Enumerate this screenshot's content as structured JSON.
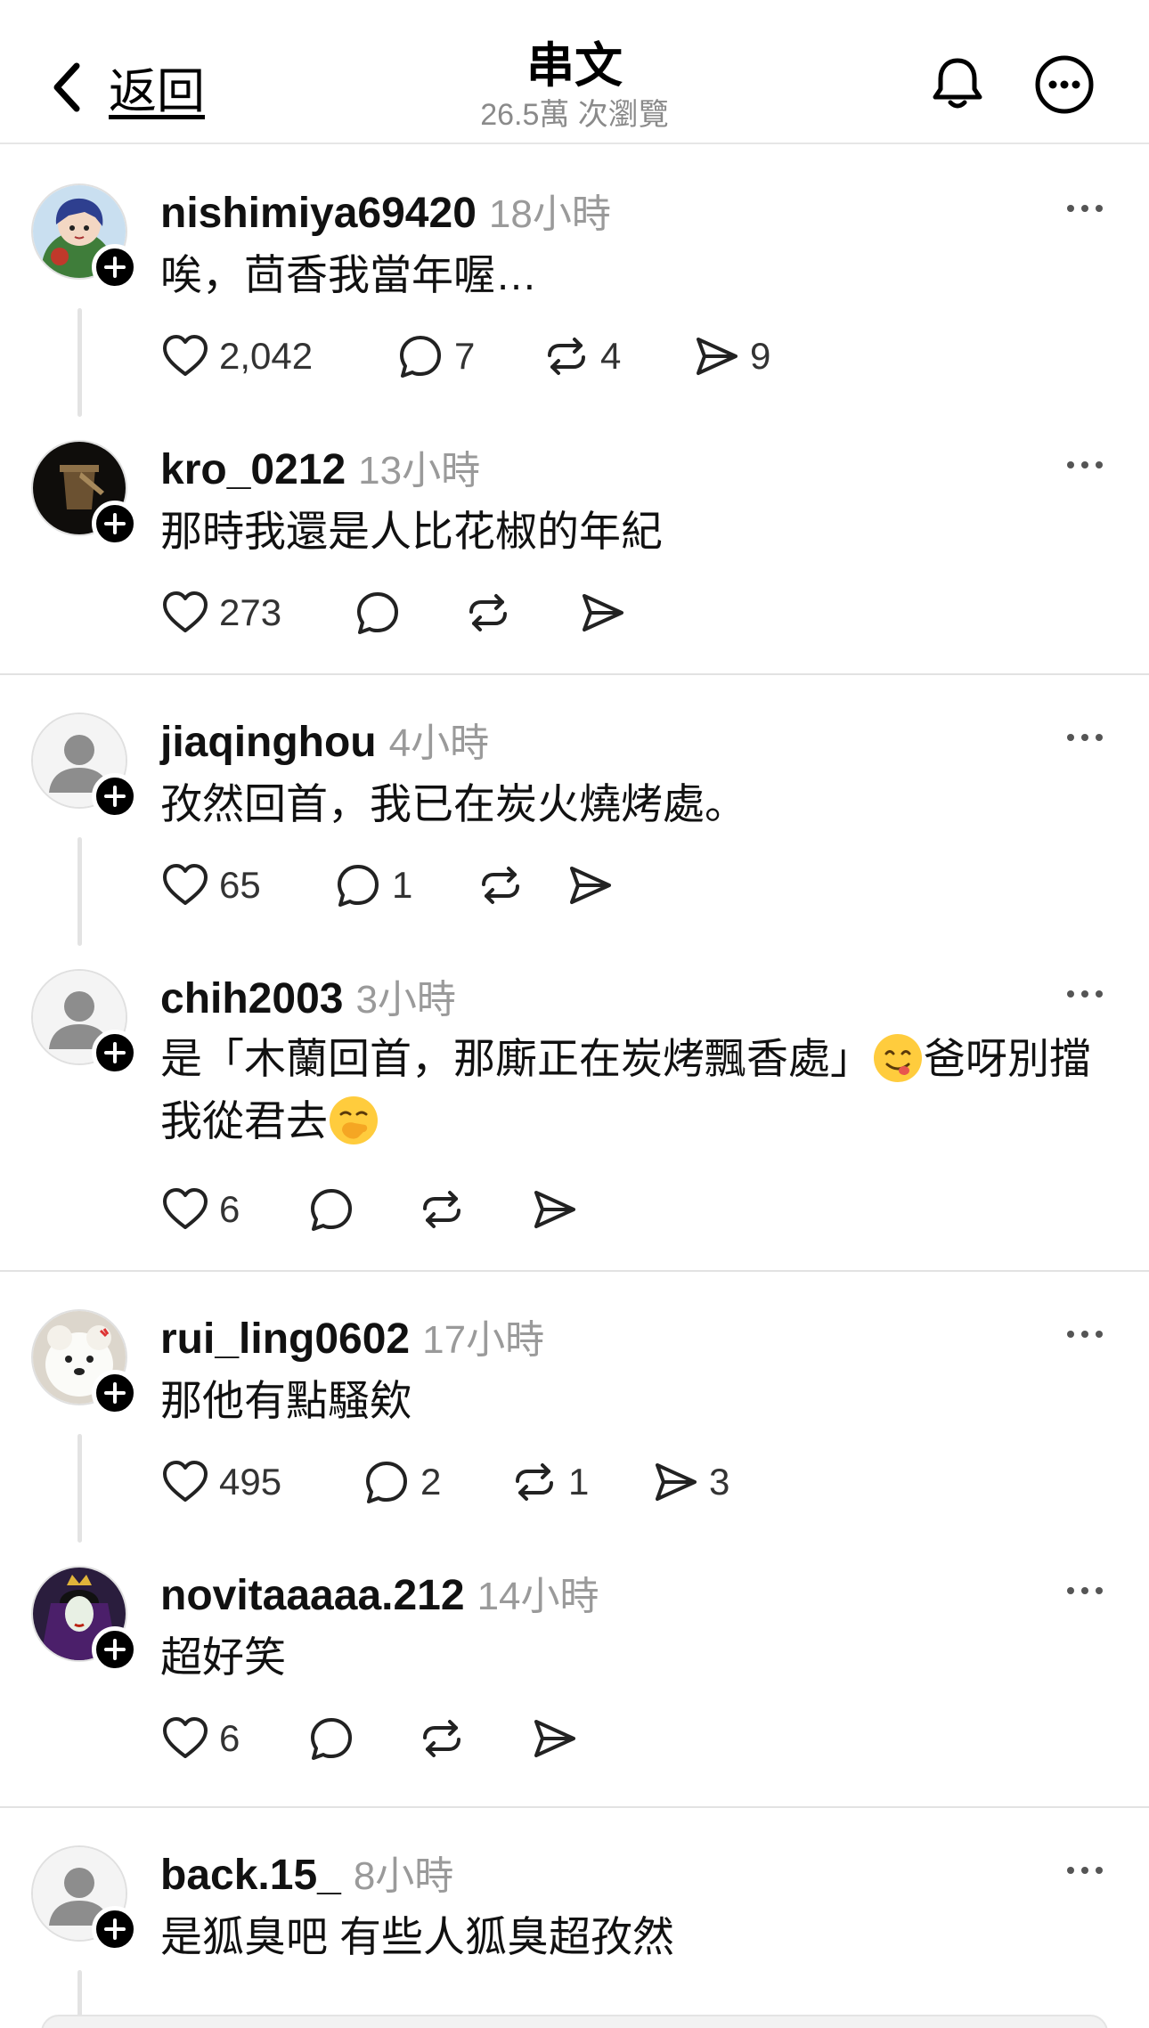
{
  "header": {
    "back_label": "返回",
    "title": "串文",
    "subtitle": "26.5萬 次瀏覽"
  },
  "posts": [
    {
      "username": "nishimiya69420",
      "time": "18小時",
      "text": "唉，茴香我當年喔…",
      "likes": "2,042",
      "replies": "7",
      "reposts": "4",
      "shares": "9"
    },
    {
      "username": "kro_0212",
      "time": "13小時",
      "text": "那時我還是人比花椒的年紀",
      "likes": "273",
      "replies": "",
      "reposts": "",
      "shares": ""
    },
    {
      "username": "jiaqinghou",
      "time": "4小時",
      "text": "孜然回首，我已在炭火燒烤處。",
      "likes": "65",
      "replies": "1",
      "reposts": "",
      "shares": ""
    },
    {
      "username": "chih2003",
      "time": "3小時",
      "text_a": "是「木蘭回首，那廝正在炭烤飄香處」",
      "text_b": "爸呀別擋我從君去",
      "likes": "6",
      "replies": "",
      "reposts": "",
      "shares": ""
    },
    {
      "username": "rui_ling0602",
      "time": "17小時",
      "text": "那他有點騷欸",
      "likes": "495",
      "replies": "2",
      "reposts": "1",
      "shares": "3"
    },
    {
      "username": "novitaaaaa.212",
      "time": "14小時",
      "text": "超好笑",
      "likes": "6",
      "replies": "",
      "reposts": "",
      "shares": ""
    },
    {
      "username": "back.15_",
      "time": "8小時",
      "text": "是狐臭吧 有些人狐臭超孜然"
    }
  ],
  "icons": {
    "emoji_1": "yum-face",
    "emoji_2": "hand-over-mouth-face"
  }
}
